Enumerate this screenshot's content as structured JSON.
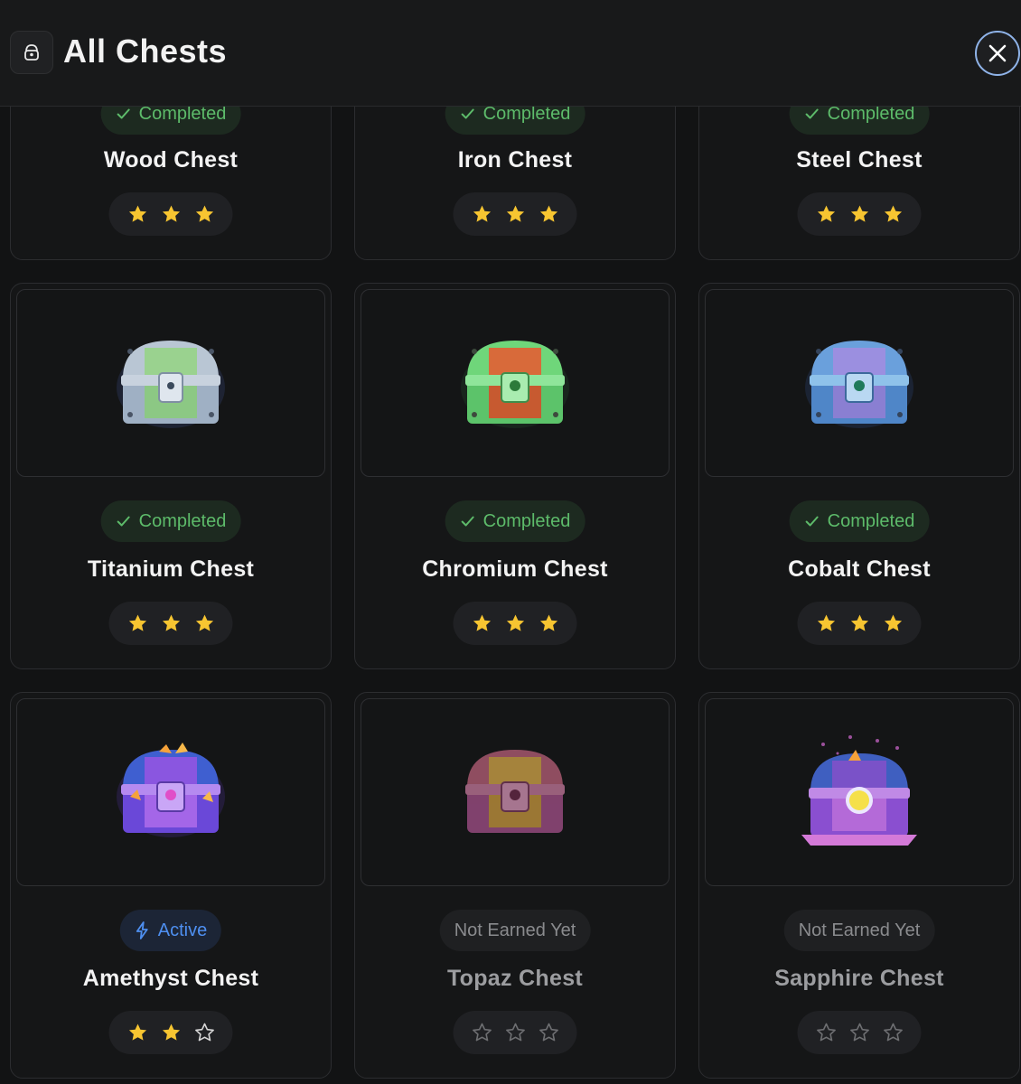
{
  "header": {
    "title": "All Chests",
    "icon": "chest-icon",
    "close_icon": "close-icon"
  },
  "status_colors": {
    "completed": "#5dbb6a",
    "active": "#4e8ff0",
    "not_earned": "#8a8b8e",
    "star_filled": "#f7c531"
  },
  "chests": [
    {
      "name": "Wood Chest",
      "status": "Completed",
      "status_type": "completed",
      "stars_earned": 3,
      "stars_total": 3
    },
    {
      "name": "Iron Chest",
      "status": "Completed",
      "status_type": "completed",
      "stars_earned": 3,
      "stars_total": 3
    },
    {
      "name": "Steel Chest",
      "status": "Completed",
      "status_type": "completed",
      "stars_earned": 3,
      "stars_total": 3
    },
    {
      "name": "Titanium Chest",
      "status": "Completed",
      "status_type": "completed",
      "stars_earned": 3,
      "stars_total": 3
    },
    {
      "name": "Chromium Chest",
      "status": "Completed",
      "status_type": "completed",
      "stars_earned": 3,
      "stars_total": 3
    },
    {
      "name": "Cobalt Chest",
      "status": "Completed",
      "status_type": "completed",
      "stars_earned": 3,
      "stars_total": 3
    },
    {
      "name": "Amethyst Chest",
      "status": "Active",
      "status_type": "active",
      "stars_earned": 2,
      "stars_total": 3
    },
    {
      "name": "Topaz Chest",
      "status": "Not Earned Yet",
      "status_type": "locked",
      "stars_earned": 0,
      "stars_total": 3
    },
    {
      "name": "Sapphire Chest",
      "status": "Not Earned Yet",
      "status_type": "locked",
      "stars_earned": 0,
      "stars_total": 3
    }
  ]
}
